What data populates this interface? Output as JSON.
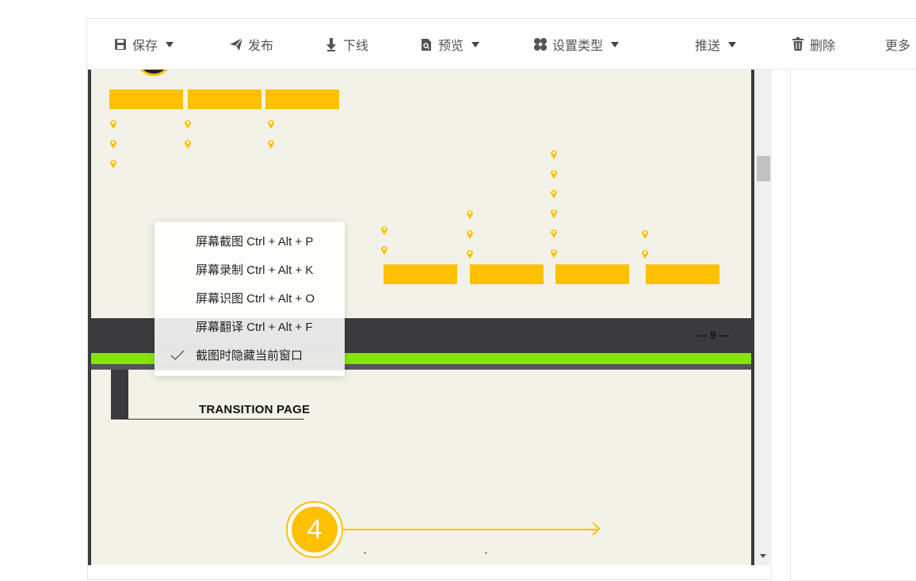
{
  "toolbar": {
    "items": [
      {
        "label": "保存",
        "icon": "save-icon",
        "has_dropdown": true
      },
      {
        "label": "发布",
        "icon": "send-icon",
        "has_dropdown": false
      },
      {
        "label": "下线",
        "icon": "download-arrow-icon",
        "has_dropdown": false
      },
      {
        "label": "预览",
        "icon": "preview-icon",
        "has_dropdown": true
      },
      {
        "label": "设置类型",
        "icon": "settings-type-icon",
        "has_dropdown": true
      },
      {
        "label": "推送",
        "icon": null,
        "has_dropdown": true
      },
      {
        "label": "删除",
        "icon": "trash-icon",
        "has_dropdown": false
      },
      {
        "label": "更多",
        "icon": null,
        "has_dropdown": false
      }
    ]
  },
  "document": {
    "page_number": "— 9 —",
    "transition_title": "TRANSITION PAGE",
    "circle_number": "4"
  },
  "context_menu": {
    "items": [
      {
        "label": "屏幕截图 Ctrl + Alt + P",
        "checked": false
      },
      {
        "label": "屏幕录制 Ctrl + Alt + K",
        "checked": false
      },
      {
        "label": "屏幕识图 Ctrl + Alt + O",
        "checked": false
      },
      {
        "label": "屏幕翻译 Ctrl + Alt + F",
        "checked": false
      },
      {
        "label": "截图时隐藏当前窗口",
        "checked": true
      }
    ]
  },
  "colors": {
    "accent_yellow": "#ffc000",
    "band_green": "#86e30c",
    "band_dark": "#3b3a3c",
    "page_bg": "#f3f2e8"
  }
}
